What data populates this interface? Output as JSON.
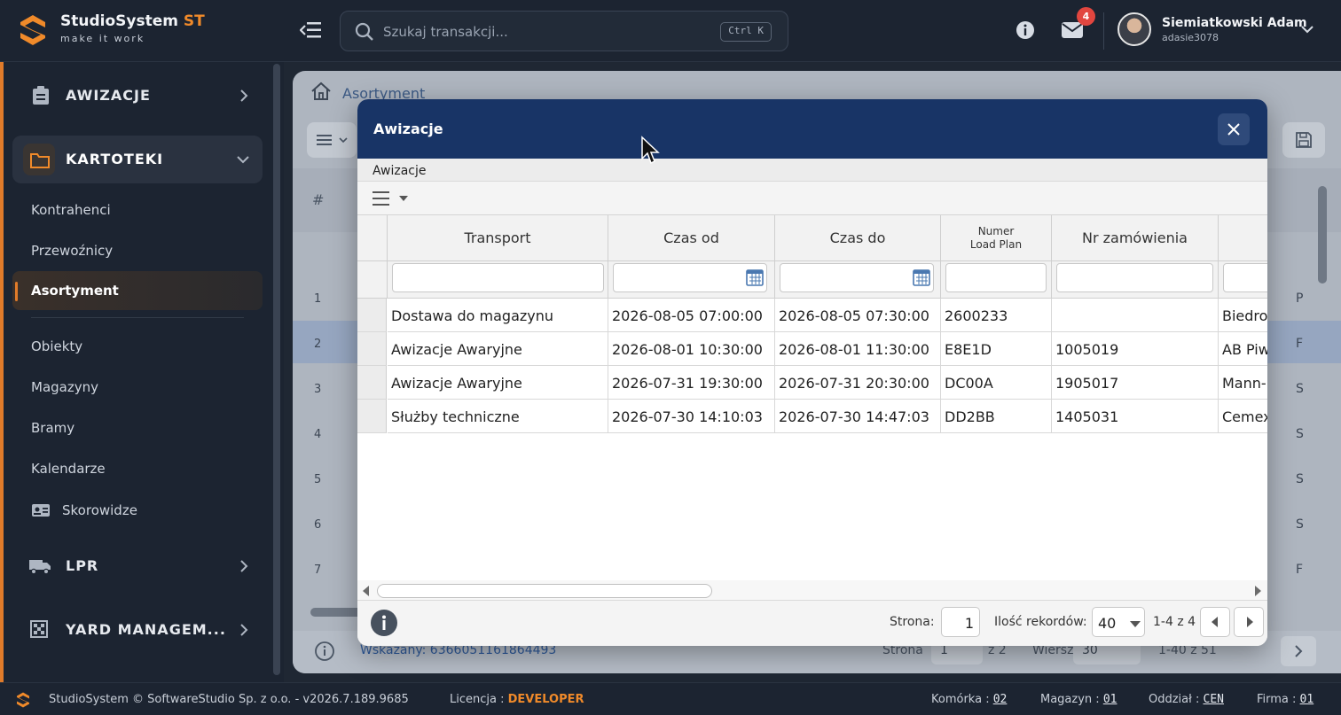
{
  "topbar": {
    "brand_name": "StudioSystem",
    "brand_suffix": "ST",
    "brand_tagline": "make it work",
    "search_placeholder": "Szukaj transakcji...",
    "search_shortcut": "Ctrl K",
    "notification_count": "4",
    "user_name": "Siemiatkowski Adam",
    "user_login": "adasie3078"
  },
  "sidebar": {
    "sections": [
      {
        "label": "AWIZACJE",
        "icon": "clipboard-icon"
      },
      {
        "label": "KARTOTEKI",
        "icon": "folder-icon",
        "expanded": true
      },
      {
        "label": "LPR",
        "icon": "truck-icon"
      },
      {
        "label": "YARD MANAGEM...",
        "icon": "grid-icon"
      }
    ],
    "items": [
      "Kontrahenci",
      "Przewoźnicy",
      "Asortyment",
      "Obiekty",
      "Magazyny",
      "Bramy",
      "Kalendarze",
      "Skorowidze"
    ],
    "active_item": "Asortyment"
  },
  "background": {
    "breadcrumb": "Asortyment",
    "hash_header": "#",
    "row_numbers": [
      "1",
      "2",
      "3",
      "4",
      "5",
      "6",
      "7"
    ],
    "right_letters": [
      "P",
      "F",
      "S",
      "S",
      "S",
      "S",
      "F"
    ],
    "footer_selected": "Wskazany: 6366051161864493",
    "footer_page_label": "Strona",
    "footer_page": "1",
    "footer_of": "z 2",
    "footer_rows_label": "Wierszy:",
    "footer_rows": "30",
    "footer_range": "1-40 z 51"
  },
  "modal": {
    "title": "Awizacje",
    "subtitle": "Awizacje",
    "columns": [
      {
        "label": "Transport"
      },
      {
        "label": "Czas od"
      },
      {
        "label": "Czas do"
      },
      {
        "label": "Numer\nLoad Plan"
      },
      {
        "label": "Nr zamówienia"
      },
      {
        "label": ""
      }
    ],
    "rows": [
      [
        "Dostawa do magazynu",
        "2026-08-05 07:00:00",
        "2026-08-05 07:30:00",
        "2600233",
        "",
        "Biedronka"
      ],
      [
        "Awizacje Awaryjne",
        "2026-08-01 10:30:00",
        "2026-08-01 11:30:00",
        "E8E1D",
        "1005019",
        "AB Piwowar"
      ],
      [
        "Awizacje Awaryjne",
        "2026-07-31 19:30:00",
        "2026-07-31 20:30:00",
        "DC00A",
        "1905017",
        "Mann-Filter"
      ],
      [
        "Służby techniczne",
        "2026-07-30 14:10:03",
        "2026-07-30 14:47:03",
        "DD2BB",
        "1405031",
        "Cemex"
      ]
    ],
    "footer": {
      "page_label": "Strona:",
      "page_value": "1",
      "records_label": "Ilość rekordów:",
      "records_value": "40",
      "range": "1-4 z 4"
    }
  },
  "statusbar": {
    "copyright": "StudioSystem © SoftwareStudio Sp. z o.o. - v2026.7.189.9685",
    "license_label": "Licencja :",
    "license_value": "DEVELOPER",
    "cell_label": "Komórka :",
    "cell_value": "02",
    "warehouse_label": "Magazyn :",
    "warehouse_value": "01",
    "branch_label": "Oddział :",
    "branch_value": "CEN",
    "company_label": "Firma :",
    "company_value": "01"
  },
  "colors": {
    "accent": "#f08a2a",
    "modal_header": "#183466",
    "sidebar_bg": "#1c2431"
  }
}
